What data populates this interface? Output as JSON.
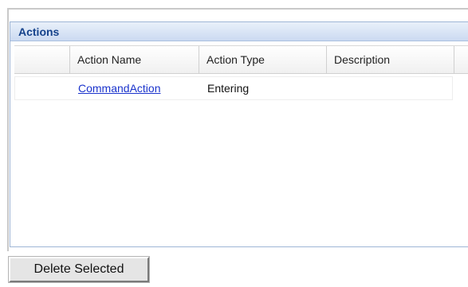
{
  "panel": {
    "title": "Actions"
  },
  "table": {
    "columns": [
      "",
      "Action Name",
      "Action Type",
      "Description"
    ],
    "rows": [
      {
        "action_name": "CommandAction",
        "action_type": "Entering",
        "description": ""
      }
    ]
  },
  "buttons": {
    "delete_selected": "Delete Selected"
  },
  "colors": {
    "header_title": "#15428b",
    "link": "#1a33cc",
    "panel_border": "#9fb6d6"
  }
}
